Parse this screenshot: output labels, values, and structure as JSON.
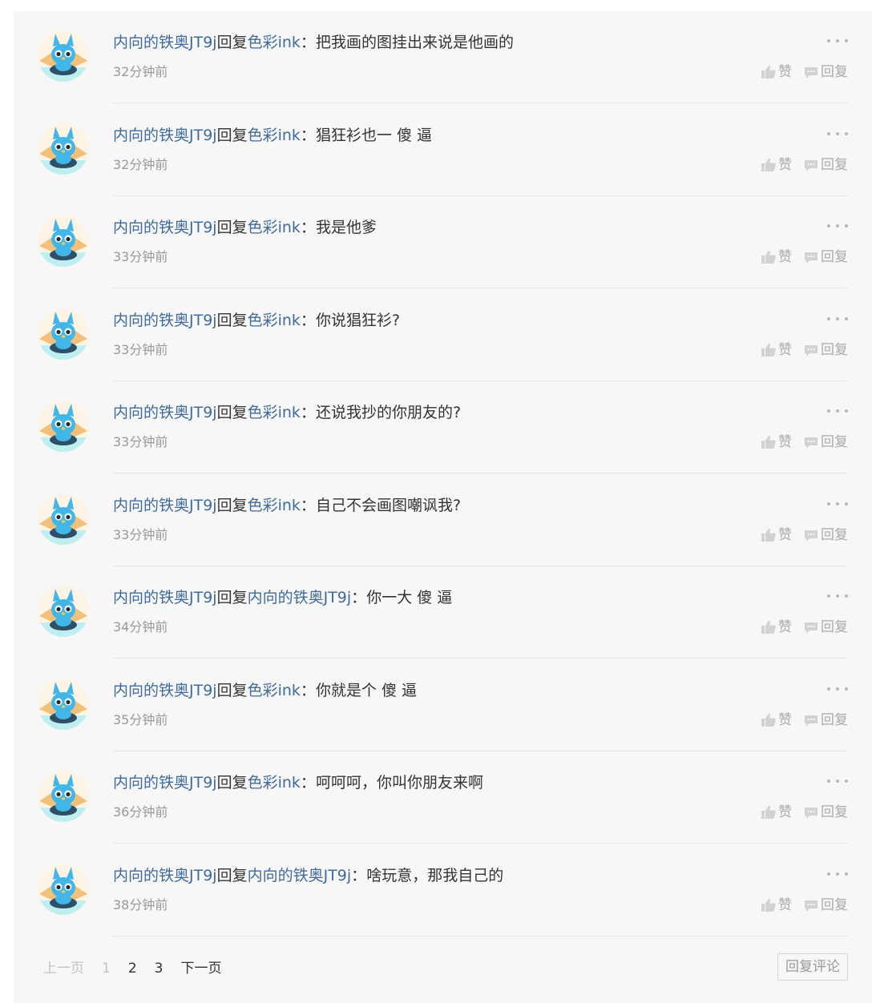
{
  "comments": [
    {
      "user": "内向的铁奥JT9j",
      "reply_word": "回复",
      "target": "色彩ink",
      "colon": "：",
      "text": "把我画的图挂出来说是他画的",
      "time": "32分钟前"
    },
    {
      "user": "内向的铁奥JT9j",
      "reply_word": "回复",
      "target": "色彩ink",
      "colon": "：",
      "text": "猖狂衫也一 傻 逼",
      "time": "32分钟前"
    },
    {
      "user": "内向的铁奥JT9j",
      "reply_word": "回复",
      "target": "色彩ink",
      "colon": "：",
      "text": "我是他爹",
      "time": "33分钟前"
    },
    {
      "user": "内向的铁奥JT9j",
      "reply_word": "回复",
      "target": "色彩ink",
      "colon": "：",
      "text": "你说猖狂衫?",
      "time": "33分钟前"
    },
    {
      "user": "内向的铁奥JT9j",
      "reply_word": "回复",
      "target": "色彩ink",
      "colon": "：",
      "text": "还说我抄的你朋友的?",
      "time": "33分钟前"
    },
    {
      "user": "内向的铁奥JT9j",
      "reply_word": "回复",
      "target": "色彩ink",
      "colon": "：",
      "text": "自己不会画图嘲讽我?",
      "time": "33分钟前"
    },
    {
      "user": "内向的铁奥JT9j",
      "reply_word": "回复",
      "target": "内向的铁奥JT9j",
      "colon": "：",
      "text": "你一大 傻 逼",
      "time": "34分钟前"
    },
    {
      "user": "内向的铁奥JT9j",
      "reply_word": "回复",
      "target": "色彩ink",
      "colon": "：",
      "text": "你就是个 傻 逼",
      "time": "35分钟前"
    },
    {
      "user": "内向的铁奥JT9j",
      "reply_word": "回复",
      "target": "色彩ink",
      "colon": "：",
      "text": "呵呵呵，你叫你朋友来啊",
      "time": "36分钟前"
    },
    {
      "user": "内向的铁奥JT9j",
      "reply_word": "回复",
      "target": "内向的铁奥JT9j",
      "colon": "：",
      "text": "啥玩意，那我自己的",
      "time": "38分钟前"
    }
  ],
  "actions": {
    "like": "赞",
    "reply": "回复"
  },
  "pagination": {
    "prev": "上一页",
    "pages": [
      "1",
      "2",
      "3"
    ],
    "current": "1",
    "next": "下一页"
  },
  "reply_comment_button": "回复评论",
  "icons": {
    "more": "more-dots-icon",
    "like": "thumbs-up-icon",
    "reply": "comment-bubble-icon",
    "avatar": "cartoon-mascot-avatar"
  },
  "colors": {
    "username": "#3f6a9c",
    "text": "#333333",
    "muted": "#999999",
    "panel": "#f7f7f7"
  }
}
